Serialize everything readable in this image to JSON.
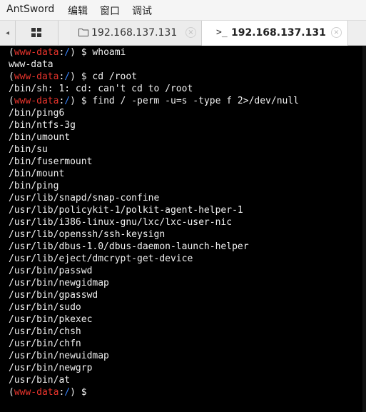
{
  "menubar": {
    "items": [
      "AntSword",
      "编辑",
      "窗口",
      "调试"
    ]
  },
  "tabs": {
    "left_arrow": "◂",
    "items": [
      {
        "label": "192.168.137.131",
        "icon": "folder-icon",
        "active": false
      },
      {
        "label": "192.168.137.131",
        "icon": "terminal-icon",
        "active": true
      }
    ]
  },
  "terminal": {
    "prompt_open": "(",
    "prompt_user": "www-data",
    "prompt_colon": ":",
    "prompt_path": "/",
    "prompt_close": ") $ ",
    "commands": [
      "whoami",
      "cd /root",
      "find / -perm -u=s -type f 2>/dev/null",
      ""
    ],
    "outputs": [
      [
        "www-data"
      ],
      [
        "/bin/sh: 1: cd: can't cd to /root"
      ],
      [
        "/bin/ping6",
        "/bin/ntfs-3g",
        "/bin/umount",
        "/bin/su",
        "/bin/fusermount",
        "/bin/mount",
        "/bin/ping",
        "/usr/lib/snapd/snap-confine",
        "/usr/lib/policykit-1/polkit-agent-helper-1",
        "/usr/lib/i386-linux-gnu/lxc/lxc-user-nic",
        "/usr/lib/openssh/ssh-keysign",
        "/usr/lib/dbus-1.0/dbus-daemon-launch-helper",
        "/usr/lib/eject/dmcrypt-get-device",
        "/usr/bin/passwd",
        "/usr/bin/newgidmap",
        "/usr/bin/gpasswd",
        "/usr/bin/sudo",
        "/usr/bin/pkexec",
        "/usr/bin/chsh",
        "/usr/bin/chfn",
        "/usr/bin/newuidmap",
        "/usr/bin/newgrp",
        "/usr/bin/at"
      ],
      []
    ]
  },
  "colors": {
    "prompt_user": "#e8342c",
    "prompt_path": "#3a86ff",
    "terminal_bg": "#000000",
    "terminal_fg": "#f0f0f0"
  }
}
